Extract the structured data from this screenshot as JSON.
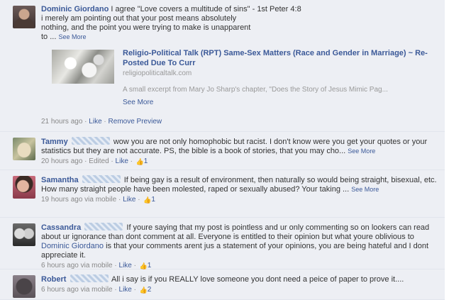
{
  "comments": [
    {
      "author": "Dominic Giordano",
      "text_lines": [
        "I agree \"Love covers a multitude of sins\" - 1st Peter 4:8",
        "i merely am pointing out that your post means absolutely",
        "nothing, and the point you were trying to make is unapparent",
        "to ..."
      ],
      "see_more": "See More",
      "attachment": {
        "title": "Religio-Political Talk (RPT) Same-Sex Matters (Race and Gender in Marriage) ~ Re-Posted Due To Curr",
        "domain": "religiopoliticaltalk.com",
        "description": "A small excerpt from Mary Jo Sharp's chapter, \"Does the Story of Jesus Mimic Pag...",
        "see_more": "See More"
      },
      "meta": {
        "time": "21 hours ago",
        "sep1": " · ",
        "like": "Like",
        "sep2": " · ",
        "remove_preview": "Remove Preview"
      }
    },
    {
      "author": "Tammy",
      "text": "wow you are not only homophobic but racist. I don't know were you get your quotes or your statistics but they are not accurate. PS, the bible is a book of stories, that you may cho...",
      "see_more": "See More",
      "meta": {
        "time": "20 hours ago",
        "sep0": " · ",
        "edited": "Edited",
        "sep1": " · ",
        "like": "Like",
        "sep2": " · ",
        "like_count": "1"
      }
    },
    {
      "author": "Samantha",
      "text": "If being gay is a result of environment, then naturally so would being straight, bisexual, etc.",
      "text2": "How many straight people have been molested, raped or sexually abused? Your taking ...",
      "see_more": "See More",
      "meta": {
        "time": "19 hours ago via mobile",
        "sep1": " · ",
        "like": "Like",
        "sep2": " · ",
        "like_count": "1"
      }
    },
    {
      "author": "Cassandra",
      "text_a": "If youre saying that my post is pointless and ur only commenting so on lookers can read about ur ignorance than dont comment at all. Everyone is entitled to their opinion but what youre oblivious to",
      "mention": "Dominic Giordano",
      "text_b": "is that your comments arent jus a statement of your opinions, you are being hateful and I dont appreciate it.",
      "meta": {
        "time": "6 hours ago via mobile",
        "sep1": " · ",
        "like": "Like",
        "sep2": " · ",
        "like_count": "1"
      }
    },
    {
      "author": "Robert",
      "text": "All i say is if you REALLY love someone you dont need a peice of paper to prove it....",
      "meta": {
        "time": "6 hours ago via mobile",
        "sep1": " · ",
        "like": "Like",
        "sep2": " · ",
        "like_count": "2"
      }
    }
  ],
  "icons": {
    "like": "thumbs-up-icon"
  },
  "colors": {
    "link": "#3b5998",
    "background": "#edeff4",
    "meta": "#888888"
  }
}
